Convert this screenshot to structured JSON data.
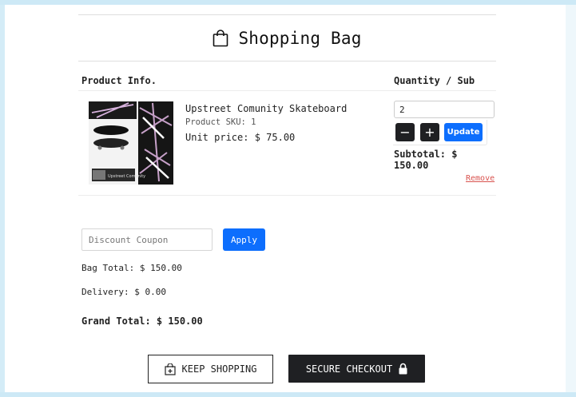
{
  "header": {
    "title": "Shopping Bag",
    "icon": "shopping-bag-icon"
  },
  "columns": {
    "product": "Product Info.",
    "quantity": "Quantity / Sub"
  },
  "item": {
    "name": "Upstreet Comunity Skateboard",
    "sku": "Product SKU: 1",
    "unit_price": "Unit price: $ 75.00",
    "quantity": "2",
    "subtotal": "Subtotal: $ 150.00",
    "remove_label": "Remove",
    "update_label": "Update",
    "minus_symbol": "−",
    "plus_symbol": "+",
    "image_caption": "Upstreet Comunity"
  },
  "coupon": {
    "placeholder": "Discount Coupon",
    "apply_label": "Apply"
  },
  "totals": {
    "bag_total": "Bag Total: $ 150.00",
    "delivery": "Delivery: $ 0.00",
    "grand_total": "Grand Total: $ 150.00"
  },
  "actions": {
    "keep_shopping": "KEEP SHOPPING",
    "secure_checkout": "SECURE CHECKOUT"
  },
  "colors": {
    "primary": "#0d6efd",
    "dark": "#1f2023",
    "danger": "#d9534f"
  }
}
